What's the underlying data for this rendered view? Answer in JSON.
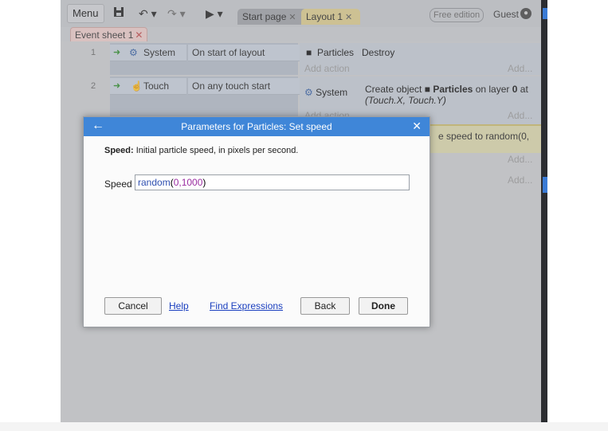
{
  "toolbar": {
    "menu": "Menu",
    "tabs": [
      {
        "label": "Start page"
      },
      {
        "label": "Layout 1"
      }
    ],
    "free_edition": "Free edition",
    "guest": "Guest"
  },
  "sheet_tab": {
    "label": "Event sheet 1"
  },
  "events": [
    {
      "number": "1",
      "condition_object": "System",
      "condition_text": "On start of layout",
      "action_object": "Particles",
      "action_text": "Destroy",
      "add_action": "Add action",
      "add": "Add..."
    },
    {
      "number": "2",
      "condition_object": "Touch",
      "condition_text": "On any touch start",
      "action_object": "System",
      "action_text_1": "Create object",
      "action_text_2": "Particles",
      "action_text_3": "on layer",
      "action_text_4": "0",
      "action_text_5": "at",
      "action_text_6": "(Touch.X, Touch.Y)",
      "add_action": "Add action",
      "add": "Add...",
      "highlight_text": "e speed to random(0,",
      "add2": "Add...",
      "add3": "Add..."
    }
  ],
  "dialog": {
    "title": "Parameters for Particles: Set speed",
    "desc_label": "Speed:",
    "desc_text": "Initial particle speed, in pixels per second.",
    "param_label": "Speed",
    "param_func": "random",
    "param_open": "(",
    "param_args": "0,1000",
    "param_close": ")",
    "buttons": {
      "cancel": "Cancel",
      "help": "Help",
      "find": "Find Expressions",
      "back": "Back",
      "done": "Done"
    }
  }
}
